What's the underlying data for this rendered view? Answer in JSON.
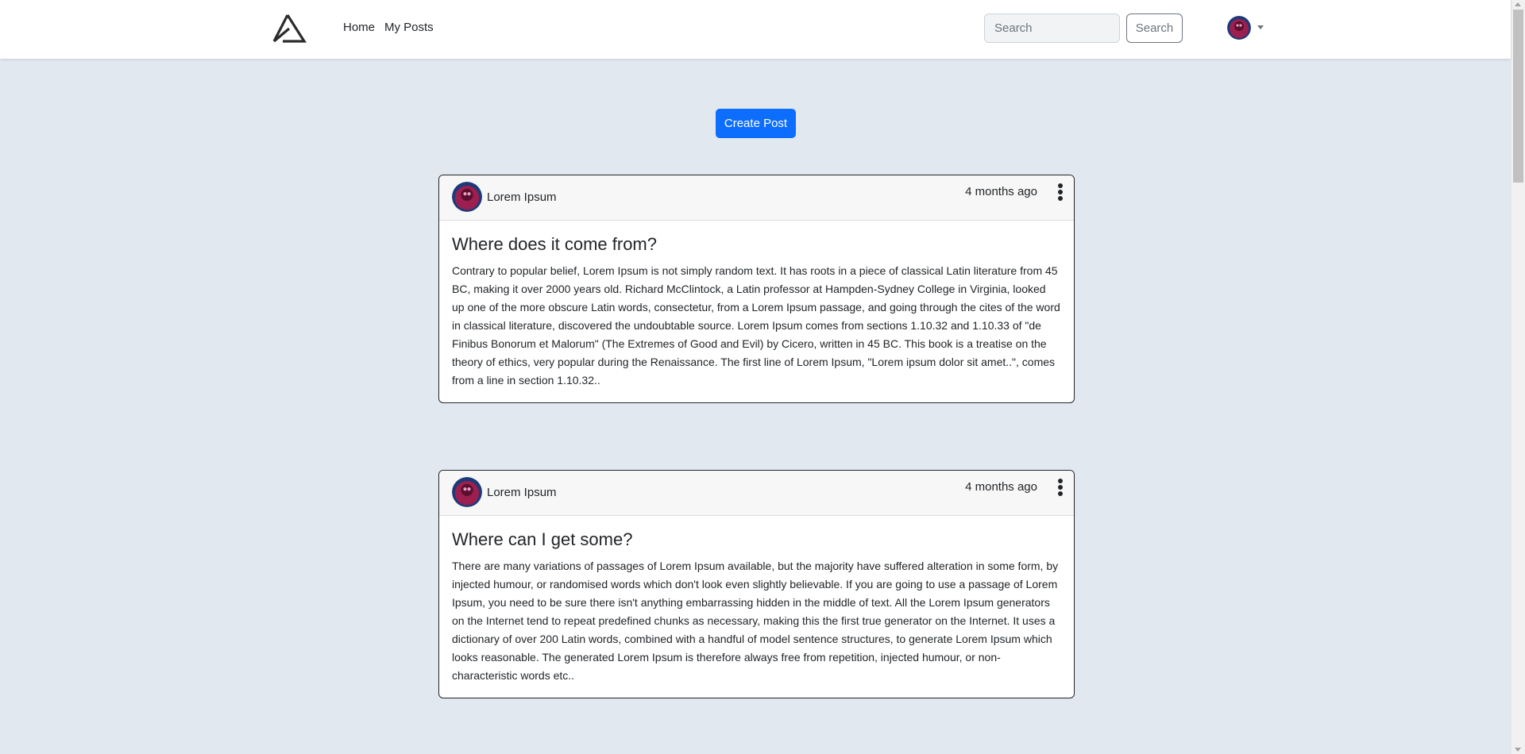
{
  "nav": {
    "links": [
      {
        "label": "Home"
      },
      {
        "label": "My Posts"
      }
    ],
    "search": {
      "placeholder": "Search",
      "value": "",
      "button_label": "Search"
    }
  },
  "main": {
    "create_post_label": "Create Post",
    "posts": [
      {
        "author": "Lorem Ipsum",
        "time": "4 months ago",
        "title": "Where does it come from?",
        "body": "Contrary to popular belief, Lorem Ipsum is not simply random text. It has roots in a piece of classical Latin literature from 45 BC, making it over 2000 years old. Richard McClintock, a Latin professor at Hampden-Sydney College in Virginia, looked up one of the more obscure Latin words, consectetur, from a Lorem Ipsum passage, and going through the cites of the word in classical literature, discovered the undoubtable source. Lorem Ipsum comes from sections 1.10.32 and 1.10.33 of \"de Finibus Bonorum et Malorum\" (The Extremes of Good and Evil) by Cicero, written in 45 BC. This book is a treatise on the theory of ethics, very popular during the Renaissance. The first line of Lorem Ipsum, \"Lorem ipsum dolor sit amet..\", comes from a line in section 1.10.32.."
      },
      {
        "author": "Lorem Ipsum",
        "time": "4 months ago",
        "title": "Where can I get some?",
        "body": "There are many variations of passages of Lorem Ipsum available, but the majority have suffered alteration in some form, by injected humour, or randomised words which don't look even slightly believable. If you are going to use a passage of Lorem Ipsum, you need to be sure there isn't anything embarrassing hidden in the middle of text. All the Lorem Ipsum generators on the Internet tend to repeat predefined chunks as necessary, making this the first true generator on the Internet. It uses a dictionary of over 200 Latin words, combined with a handful of model sentence structures, to generate Lorem Ipsum which looks reasonable. The generated Lorem Ipsum is therefore always free from repetition, injected humour, or non-characteristic words etc.."
      }
    ]
  },
  "icons": {
    "logo": "brand-logo-icon",
    "avatar": "user-avatar",
    "menu": "kebab-menu-icon",
    "caret": "caret-down-icon"
  },
  "colors": {
    "page_background": "#e2e8f0",
    "primary": "#0d6efd",
    "text": "#212529"
  }
}
